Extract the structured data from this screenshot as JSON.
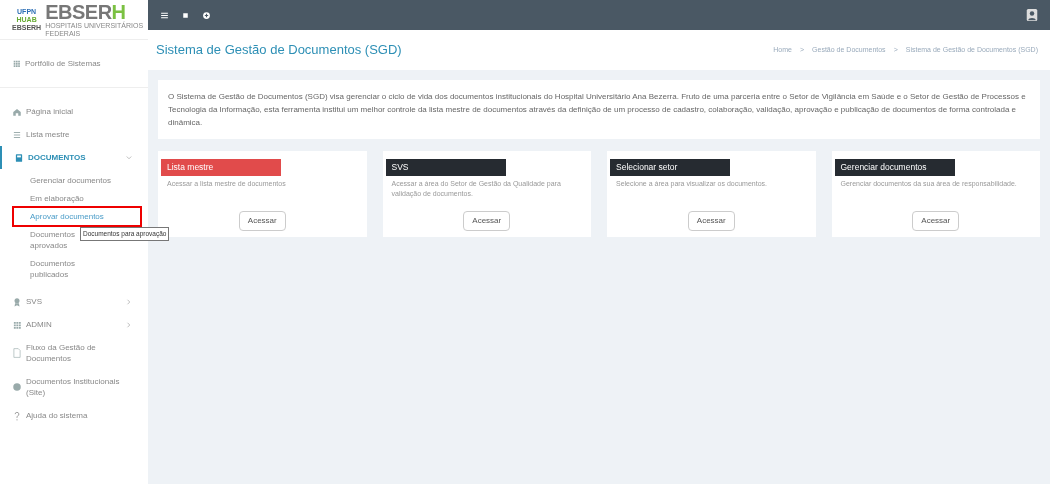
{
  "logo": {
    "badge_top": "UFPN",
    "badge_mid": "HUAB",
    "badge_bottom": "EBSERH",
    "name": "EBSERH",
    "tagline": "HOSPITAIS UNIVERSITÁRIOS FEDERAIS"
  },
  "sidebar": {
    "portfolio": "Portfólio de Sistemas",
    "items": [
      {
        "kind": "link",
        "label": "Página inicial",
        "selected": false
      },
      {
        "kind": "link",
        "label": "Lista mestre",
        "selected": false
      },
      {
        "kind": "group",
        "label": "DOCUMENTOS",
        "expanded": true,
        "selected": true,
        "children": [
          {
            "label": "Gerenciar documentos",
            "selected": false
          },
          {
            "label": "Em elaboração",
            "selected": false
          },
          {
            "label": "Aprovar documentos",
            "selected": true
          },
          {
            "label": "Documentos aprovados",
            "selected": false
          },
          {
            "label": "Documentos publicados",
            "selected": false
          }
        ]
      },
      {
        "kind": "group",
        "label": "SVS",
        "expanded": false,
        "selected": false
      },
      {
        "kind": "group",
        "label": "ADMIN",
        "expanded": false,
        "selected": false
      },
      {
        "kind": "link",
        "label": "Fluxo da Gestão de Documentos",
        "selected": false
      },
      {
        "kind": "link",
        "label": "Documentos Institucionais (Site)",
        "selected": false
      },
      {
        "kind": "link",
        "label": "Ajuda do sistema",
        "selected": false
      }
    ]
  },
  "tooltip": "Documentos para aprovação",
  "page_title": "Sistema de Gestão de Documentos (SGD)",
  "breadcrumb": [
    "Home",
    "Gestão de Documentos",
    "Sistema de Gestão de Documentos (SGD)"
  ],
  "breadcrumb_separators": [
    ">",
    ">"
  ],
  "intro": "O Sistema de Gestão de Documentos (SGD) visa gerenciar o ciclo de vida dos documentos institucionais do Hospital Universitário Ana Bezerra. Fruto de uma parceria entre o Setor de Vigilância em Saúde e o Setor de Gestão de Processos e Tecnologia da Informação, esta ferramenta institui um melhor controle da lista mestre de documentos através da definição de um processo de cadastro, colaboração, validação, aprovação e publicação de documentos de forma controlada e dinâmica.",
  "cards": [
    {
      "title": "Lista mestre",
      "color": "#e14b4b",
      "text": "Acessar a lista mestre de documentos",
      "button": "Acessar"
    },
    {
      "title": "SVS",
      "color": "#262b31",
      "text": "Acessar a área do Setor de Gestão da Qualidade para validação de documentos.",
      "button": "Acessar"
    },
    {
      "title": "Selecionar setor",
      "color": "#262b31",
      "text": "Selecione a área para visualizar os documentos.",
      "button": "Acessar"
    },
    {
      "title": "Gerenciar documentos",
      "color": "#262b31",
      "text": "Gerenciar documentos da sua área de responsabilidade.",
      "button": "Acessar"
    }
  ]
}
